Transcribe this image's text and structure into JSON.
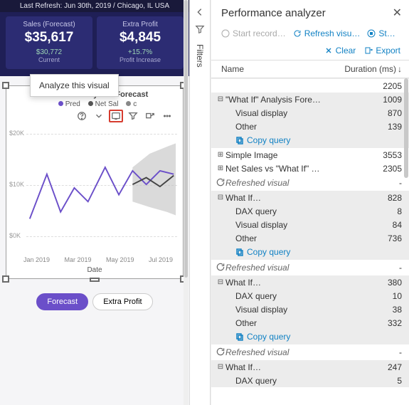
{
  "left": {
    "refresh": "Last Refresh: Jun 30th, 2019 / Chicago, IL USA",
    "cards": [
      {
        "title": "Sales (Forecast)",
        "value": "$35,617",
        "sub": "$30,772",
        "sublab": "Current"
      },
      {
        "title": "Extra Profit",
        "value": "$4,845",
        "sub": "+15.7%",
        "sublab": "Profit Increase"
      }
    ],
    "tooltip": "Analyze this visual",
    "chart": {
      "title": "\"What If\" Analysis - Forecast",
      "legend": [
        {
          "label": "Pred",
          "color": "#6b4fc9"
        },
        {
          "label": "Net Sal",
          "color": "#555"
        },
        {
          "label": "c",
          "color": "#555"
        }
      ],
      "xlabel": "Date",
      "xTicks": [
        "Jan 2019",
        "Mar 2019",
        "May 2019",
        "Jul 2019"
      ],
      "yTicks": [
        "$20K",
        "$10K",
        "$0K"
      ]
    },
    "buttons": {
      "forecast": "Forecast",
      "extra": "Extra Profit"
    }
  },
  "filters": {
    "label": "Filters"
  },
  "panel": {
    "title": "Performance analyzer",
    "actions": {
      "start": "Start record…",
      "refresh": "Refresh visu…",
      "stop": "St…",
      "clear": "Clear",
      "export": "Export"
    },
    "columns": {
      "name": "Name",
      "dur": "Duration (ms)"
    },
    "copy": "Copy query",
    "refreshed": "Refreshed visual",
    "rows": [
      {
        "type": "cut",
        "val": "2205"
      },
      {
        "type": "parent",
        "band": true,
        "exp": "minus",
        "name": "\"What If\" Analysis Fore…",
        "val": "1009"
      },
      {
        "type": "child",
        "band": true,
        "name": "Visual display",
        "val": "870"
      },
      {
        "type": "child",
        "band": true,
        "name": "Other",
        "val": "139"
      },
      {
        "type": "copy",
        "band": true
      },
      {
        "type": "parent",
        "exp": "plus",
        "name": "Simple Image",
        "val": "3553"
      },
      {
        "type": "parent",
        "exp": "plus",
        "name": "Net Sales vs \"What If\" …",
        "val": "2305"
      },
      {
        "type": "refreshed"
      },
      {
        "type": "parent",
        "band": true,
        "exp": "minus",
        "name": "What If…",
        "val": "828"
      },
      {
        "type": "child",
        "band": true,
        "name": "DAX query",
        "val": "8"
      },
      {
        "type": "child",
        "band": true,
        "name": "Visual display",
        "val": "84"
      },
      {
        "type": "child",
        "band": true,
        "name": "Other",
        "val": "736"
      },
      {
        "type": "copy",
        "band": true,
        "blue": true
      },
      {
        "type": "refreshed"
      },
      {
        "type": "parent",
        "band": true,
        "exp": "minus",
        "name": "What If…",
        "val": "380"
      },
      {
        "type": "child",
        "band": true,
        "name": "DAX query",
        "val": "10"
      },
      {
        "type": "child",
        "band": true,
        "name": "Visual display",
        "val": "38"
      },
      {
        "type": "child",
        "band": true,
        "name": "Other",
        "val": "332"
      },
      {
        "type": "copy",
        "band": true,
        "blue": true
      },
      {
        "type": "refreshed"
      },
      {
        "type": "parent",
        "band": true,
        "exp": "minus",
        "name": "What If…",
        "val": "247"
      },
      {
        "type": "child",
        "band": true,
        "name": "DAX query",
        "val": "5"
      }
    ]
  },
  "chart_data": {
    "type": "line",
    "title": "\"What If\" Analysis - Forecast",
    "xlabel": "Date",
    "ylabel": "",
    "ylim": [
      0,
      20000
    ],
    "x": [
      "Jan 2019",
      "Feb 2019",
      "Mar 2019",
      "Apr 2019",
      "May 2019",
      "Jun 2019",
      "Jul 2019",
      "Aug 2019"
    ],
    "series": [
      {
        "name": "Pred",
        "color": "#6b4fc9",
        "values": [
          4000,
          12000,
          5000,
          9000,
          7000,
          13000,
          9000,
          12000
        ]
      },
      {
        "name": "Net Sales",
        "color": "#555",
        "values": [
          null,
          null,
          null,
          null,
          null,
          null,
          10000,
          11500
        ]
      }
    ],
    "confidence_band": {
      "start": "Jun 2019",
      "low": [
        7000,
        6000,
        5500
      ],
      "high": [
        14000,
        15000,
        16000
      ]
    }
  }
}
